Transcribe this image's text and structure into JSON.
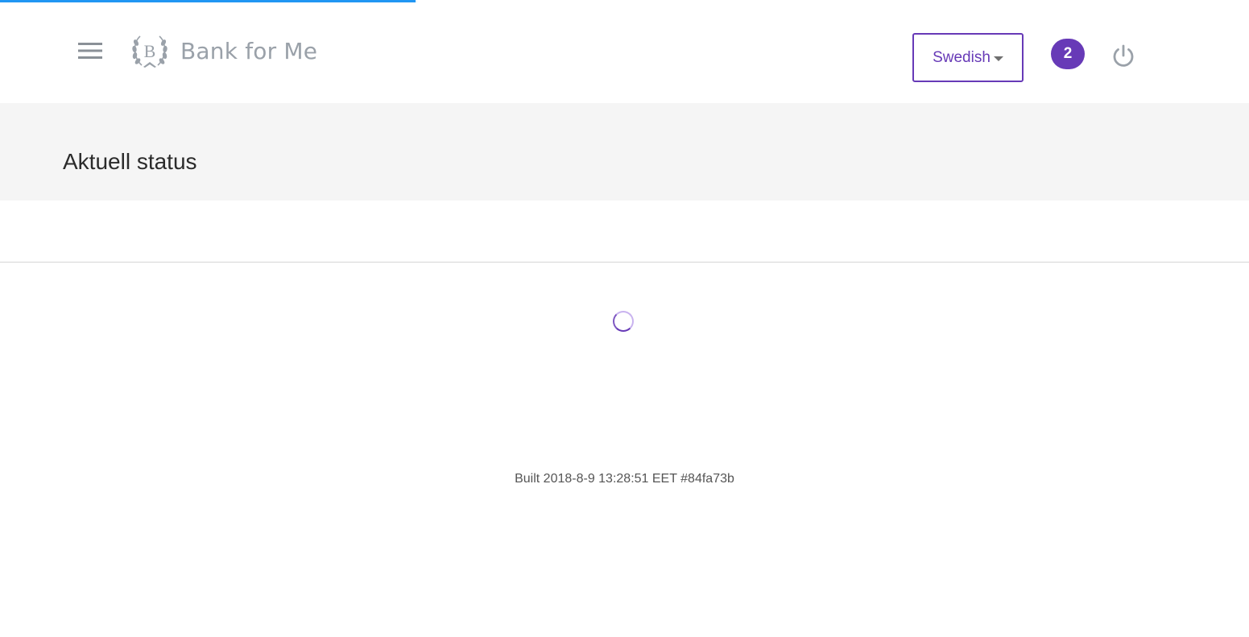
{
  "loading": {
    "progress": 0.333
  },
  "header": {
    "menu_icon": "hamburger-menu-icon",
    "logo_icon": "laurel-b-crest-icon",
    "logo_monogram": "B",
    "brand_name": "Bank for Me",
    "language": {
      "selected": "Swedish",
      "icon": "caret-down-icon"
    },
    "notifications": {
      "count": "2"
    },
    "power_icon": "power-icon"
  },
  "page": {
    "title": "Aktuell status"
  },
  "content": {
    "spinner_icon": "loading-spinner-icon"
  },
  "footer": {
    "build": "Built 2018-8-9 13:28:51 EET #84fa73b"
  },
  "colors": {
    "accent": "#673ab7",
    "progress": "#2196f3",
    "band": "#f5f5f5",
    "muted_icon": "#9aa1a9"
  }
}
